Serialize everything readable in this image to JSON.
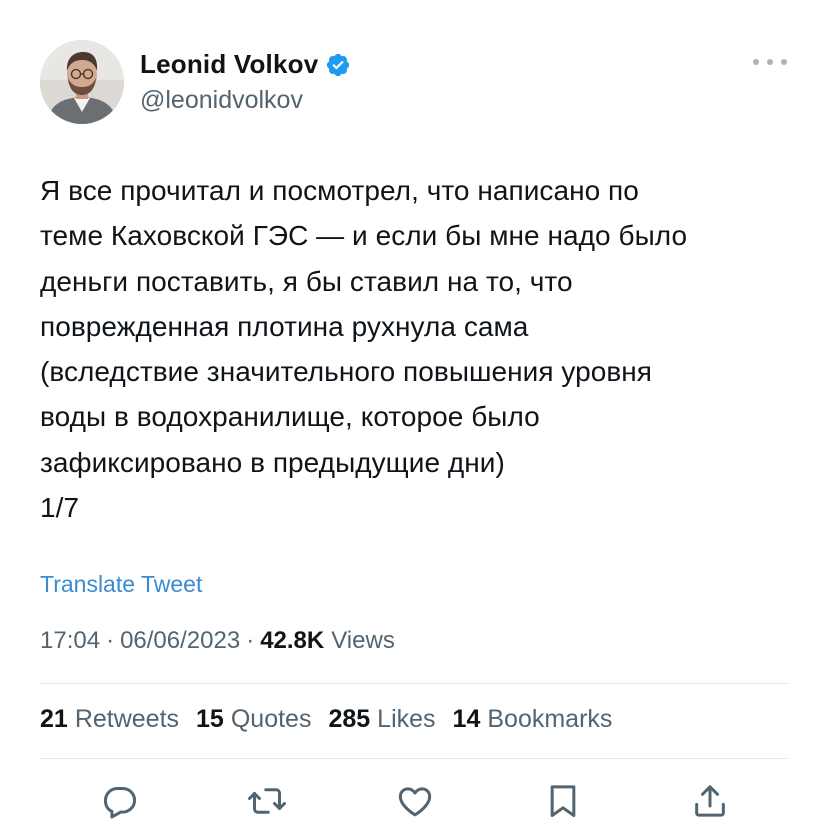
{
  "author": {
    "name": "Leonid Volkov",
    "handle": "@leonidvolkov",
    "verified": true,
    "avatar_icon": "profile-photo"
  },
  "tweet": {
    "text": "Я все прочитал и посмотрел, что написано по\nтеме Каховской ГЭС — и если бы мне надо было\nденьги поставить, я бы ставил на то, что\nповрежденная плотина рухнула сама\n(вследствие значительного повышения уровня\nводы в водохранилище, которое было\nзафиксировано в предыдущие дни)\n1/7",
    "translate_label": "Translate Tweet",
    "time": "17:04",
    "separator": "·",
    "date": "06/06/2023",
    "views_count": "42.8K",
    "views_label": "Views"
  },
  "stats": {
    "retweets": {
      "count": "21",
      "label": "Retweets"
    },
    "quotes": {
      "count": "15",
      "label": "Quotes"
    },
    "likes": {
      "count": "285",
      "label": "Likes"
    },
    "bookmarks": {
      "count": "14",
      "label": "Bookmarks"
    }
  },
  "actions": [
    "reply-icon",
    "retweet-icon",
    "like-icon",
    "bookmark-icon",
    "share-icon"
  ],
  "colors": {
    "text": "#0f1419",
    "secondary": "#536471",
    "link": "#3a8bd0",
    "verified": "#1d9bf0",
    "divider": "#e4e8eb"
  }
}
